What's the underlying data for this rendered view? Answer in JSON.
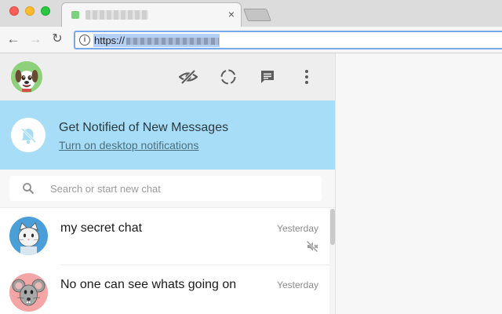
{
  "browser": {
    "tab_close": "×",
    "back_glyph": "←",
    "forward_glyph": "→",
    "reload_glyph": "↻",
    "info_glyph": "i",
    "url_prefix": "https://"
  },
  "app": {
    "header": {
      "icons": [
        "eye-off-icon",
        "status-icon",
        "new-chat-icon",
        "menu-dots-icon"
      ]
    },
    "notification": {
      "title": "Get Notified of New Messages",
      "link": "Turn on desktop notifications"
    },
    "search": {
      "placeholder": "Search or start new chat"
    },
    "chats": [
      {
        "name": "my secret chat",
        "time": "Yesterday",
        "muted": true,
        "avatar": "cat-avatar"
      },
      {
        "name": "No one can see whats going on",
        "time": "Yesterday",
        "muted": false,
        "avatar": "mouse-avatar"
      }
    ]
  },
  "colors": {
    "notify_bg": "#a7ddf6",
    "header_bg": "#eeeeee",
    "avatar_cat_bg": "#4a9fd8",
    "avatar_mouse_bg": "#f4a5a5",
    "url_highlight": "#b4d0f5"
  }
}
